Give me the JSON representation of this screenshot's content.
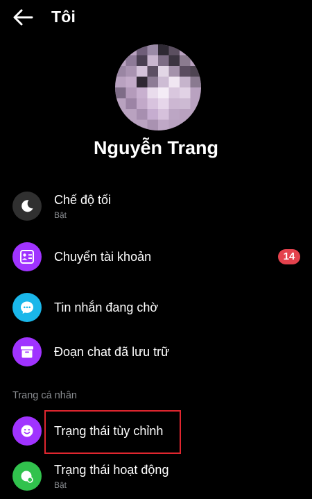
{
  "header": {
    "title": "Tôi",
    "back_icon": "back-arrow-icon"
  },
  "profile": {
    "name": "Nguyễn Trang"
  },
  "menu": {
    "items": [
      {
        "label": "Chế độ tối",
        "sublabel": "Bật",
        "icon": "moon-icon",
        "icon_bg": "#303030"
      },
      {
        "label": "Chuyển tài khoản",
        "badge": "14",
        "icon": "switch-account-icon",
        "icon_bg": "#a033ff"
      },
      {
        "label": "Tin nhắn đang chờ",
        "icon": "chat-bubble-icon",
        "icon_bg": "#1ab7ea"
      },
      {
        "label": "Đoạn chat đã lưu trữ",
        "icon": "archive-box-icon",
        "icon_bg": "#a033ff"
      }
    ]
  },
  "profile_section": {
    "title": "Trang cá nhân",
    "items": [
      {
        "label": "Trạng thái tùy chỉnh",
        "icon": "smiley-icon",
        "icon_bg": "#a033ff",
        "highlighted": true
      },
      {
        "label": "Trạng thái hoạt động",
        "sublabel": "Bật",
        "icon": "active-status-icon",
        "icon_bg": "#31c24d"
      }
    ]
  },
  "colors": {
    "background": "#000000",
    "badge": "#e4424d",
    "highlight_border": "#e0262f",
    "secondary_text": "#8a8d91"
  }
}
